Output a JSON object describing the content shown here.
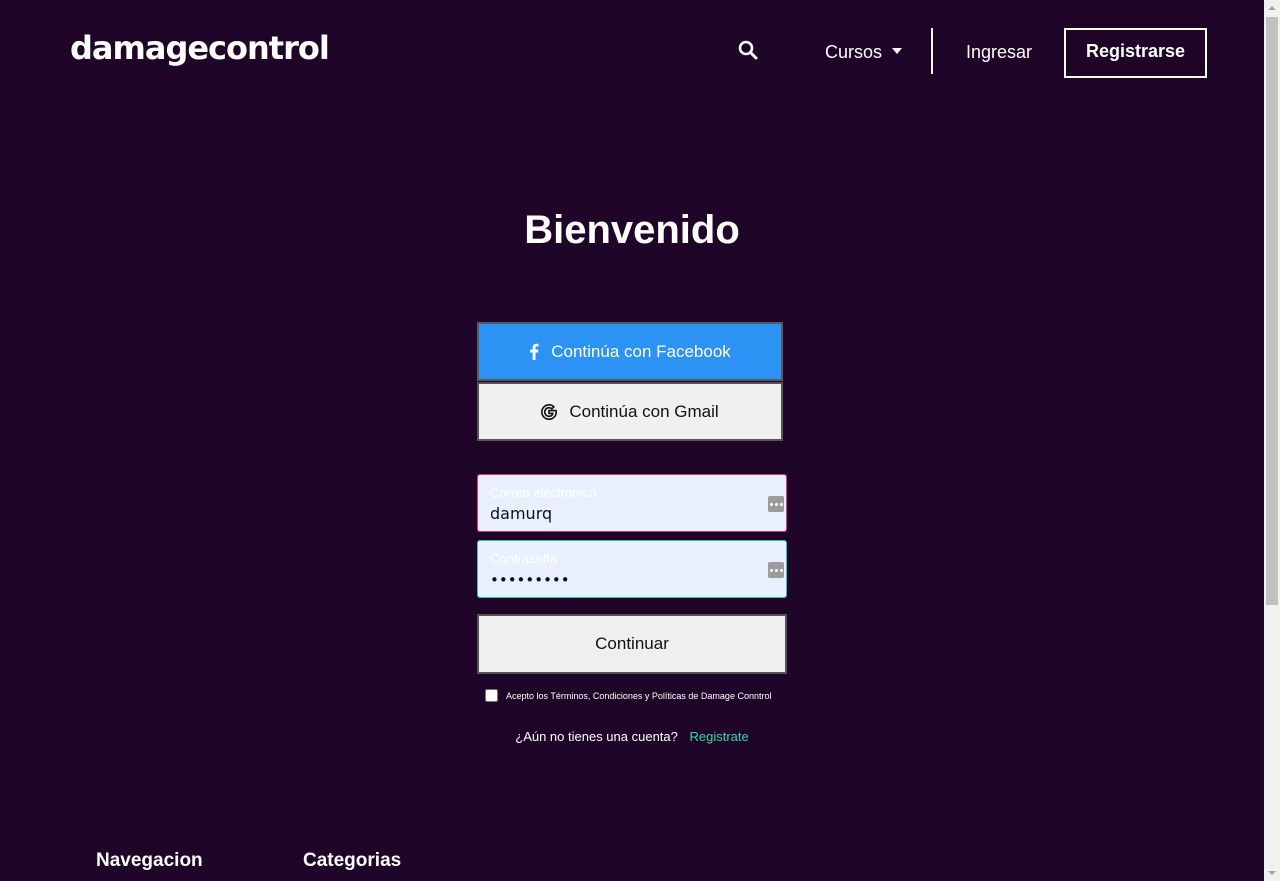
{
  "header": {
    "logo": "damagecontrol",
    "search_icon": "search-icon",
    "cursos_label": "Cursos",
    "ingresar_label": "Ingresar",
    "registrarse_label": "Registrarse"
  },
  "main": {
    "title": "Bienvenido",
    "facebook_label": "Continúa con Facebook",
    "gmail_label": "Continúa con Gmail",
    "email": {
      "label": "Correo electronico",
      "value": "damurq"
    },
    "password": {
      "label": "Contraseña",
      "value": "•••••••••"
    },
    "continue_label": "Continuar",
    "terms_text": "Acepto los Términos, Condiciones y Políticas de Damage Conntrol",
    "no_account_text": "¿Aún no tienes una cuenta?",
    "signup_link": "Registrate"
  },
  "footer": {
    "nav_heading": "Navegacion",
    "categories_heading": "Categorias"
  },
  "colors": {
    "background": "#1f0628",
    "facebook": "#2c92f3",
    "link": "#2fd8a6",
    "email_border": "#e4386a",
    "password_border": "#27c9a8"
  }
}
